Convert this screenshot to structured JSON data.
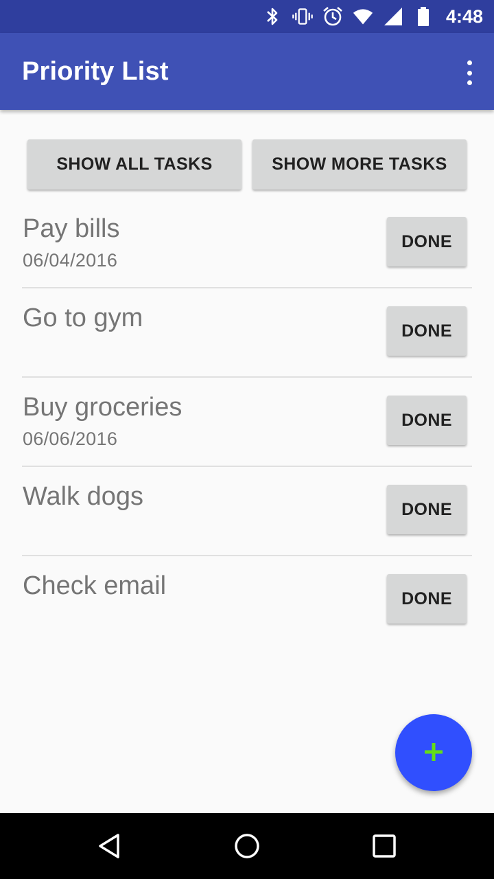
{
  "status_bar": {
    "time": "4:48",
    "icons": [
      "bluetooth-icon",
      "vibrate-icon",
      "alarm-icon",
      "wifi-icon",
      "signal-icon",
      "battery-icon"
    ]
  },
  "app_bar": {
    "title": "Priority List",
    "overflow_icon": "more-vert-icon"
  },
  "buttons": {
    "show_all": "SHOW ALL TASKS",
    "show_more": "SHOW MORE TASKS"
  },
  "tasks": [
    {
      "name": "Pay bills",
      "date": "06/04/2016",
      "button": "DONE"
    },
    {
      "name": "Go to gym",
      "date": "",
      "button": "DONE"
    },
    {
      "name": "Buy groceries",
      "date": "06/06/2016",
      "button": "DONE"
    },
    {
      "name": "Walk dogs",
      "date": "",
      "button": "DONE"
    },
    {
      "name": "Check email",
      "date": "",
      "button": "DONE"
    }
  ],
  "fab": {
    "icon": "add-icon",
    "color": "#304ffe",
    "icon_color": "#64dd17"
  },
  "colors": {
    "status_bar": "#2f3e9e",
    "app_bar": "#3f51b5",
    "background": "#fafafa",
    "button": "#d6d7d7"
  },
  "nav_bar": {
    "icons": [
      "back-icon",
      "home-icon",
      "recents-icon"
    ]
  }
}
